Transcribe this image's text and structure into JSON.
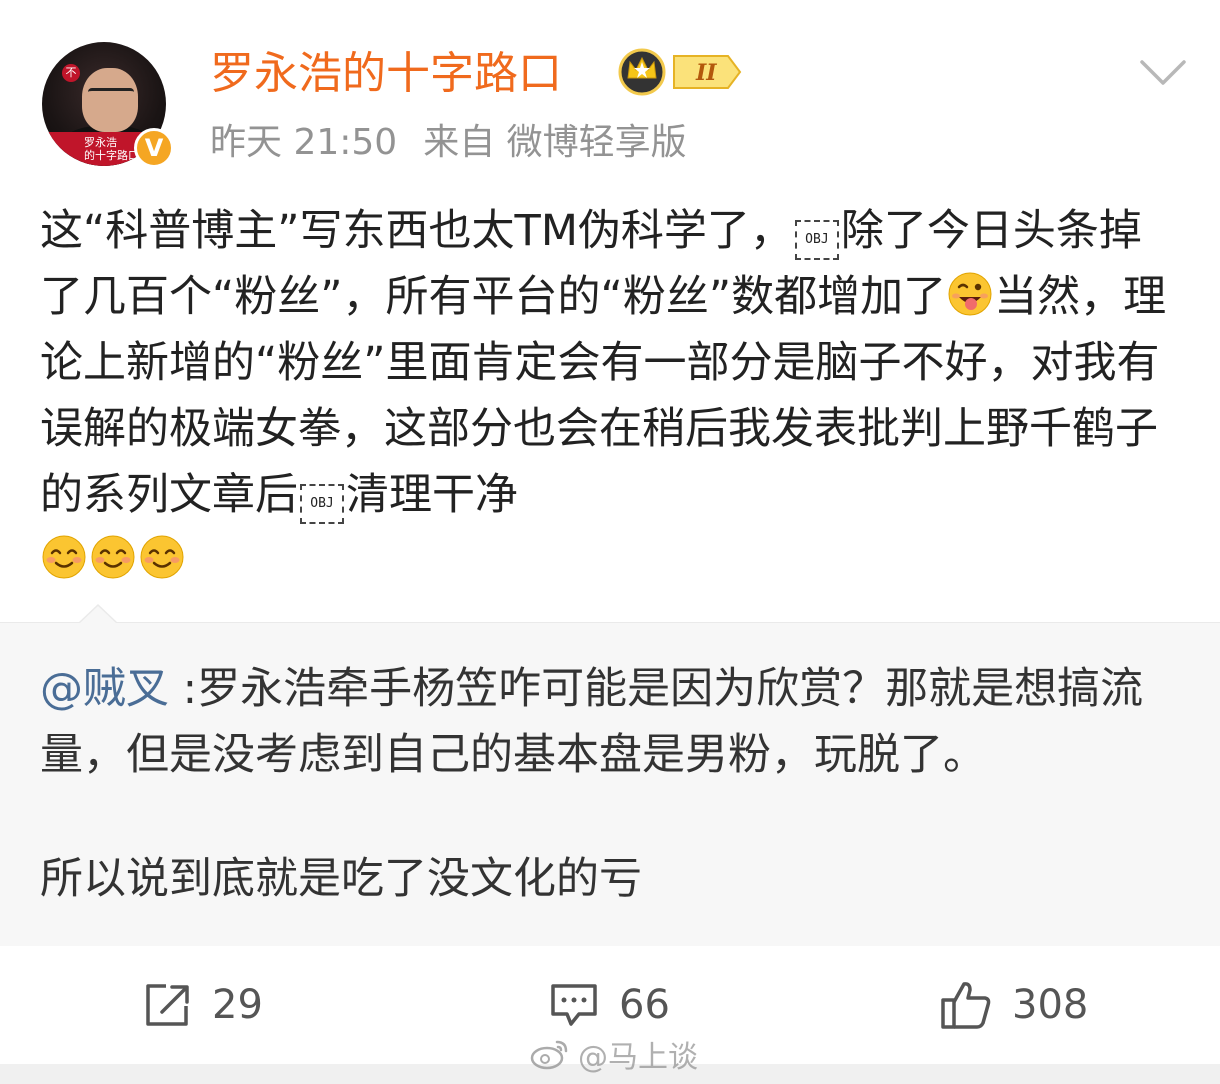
{
  "author": {
    "name": "罗永浩的十字路口",
    "avatar_banner": "罗永浩\n的十字路口",
    "verified_mark": "V",
    "level_badge": "II",
    "timestamp": "昨天 21:50",
    "source": "来自 微博轻享版"
  },
  "post": {
    "segments": [
      {
        "t": "text",
        "v": "这“科普博主”写东西也太TM伪科学了，"
      },
      {
        "t": "obj",
        "v": "OBJ"
      },
      {
        "t": "text",
        "v": "除了今日头条掉了几百个“粉丝”，所有平台的“粉丝”数都增加了"
      },
      {
        "t": "emoji",
        "v": "wink-tongue"
      },
      {
        "t": "text",
        "v": "当然，理论上新增的“粉丝”里面肯定会有一部分是脑子不好，对我有误解的极端女拳，这部分也会在稍后我发表批判上野千鹤子的系列文章后"
      },
      {
        "t": "obj",
        "v": "OBJ"
      },
      {
        "t": "text",
        "v": "清理干净"
      }
    ],
    "part1": "这“科普博主”写东西也太TM伪科学了，",
    "part2": "除了今日头条掉了几百个“粉丝”，所有平台的“粉丝”数都增加了",
    "part3": "当然，理论上新增的“粉丝”里面肯定会有一部分是脑子不好，对我有误解的极端女拳，这部分也会在稍后我发表批判上野千鹤子的系列文章后",
    "part4": "清理干净",
    "obj_label": "OBJ",
    "trailing_emojis": [
      "smile",
      "smile",
      "smile"
    ]
  },
  "retweet": {
    "mention": "@贼叉",
    "text": " :罗永浩牵手杨笠咋可能是因为欣赏？那就是想搞流量，但是没考虑到自己的基本盘是男粉，玩脱了。",
    "text2": "所以说到底就是吃了没文化的亏"
  },
  "actions": {
    "repost_count": "29",
    "comment_count": "66",
    "like_count": "308"
  },
  "watermark": "@马上谈",
  "colors": {
    "username": "#f06a1d",
    "mention": "#4a6d96",
    "meta": "#939393",
    "badge_gold": "#f5a623"
  }
}
